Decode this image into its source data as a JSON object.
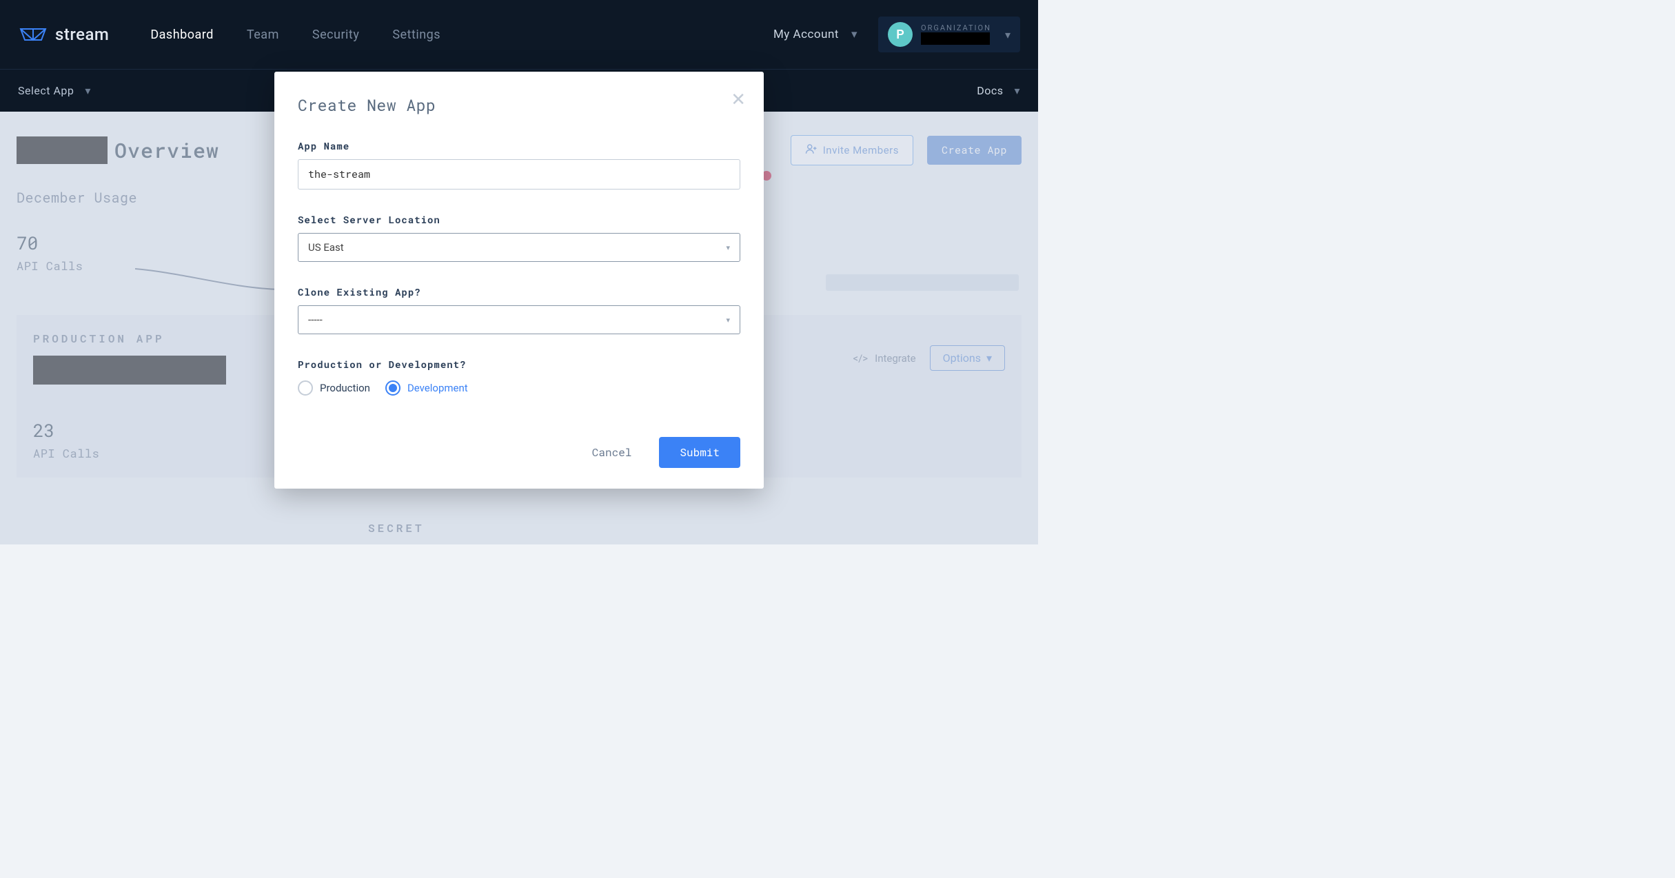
{
  "header": {
    "logo_text": "stream",
    "nav": {
      "dashboard": "Dashboard",
      "team": "Team",
      "security": "Security",
      "settings": "Settings"
    },
    "my_account": "My Account",
    "org_label": "ORGANIZATION",
    "avatar_letter": "P"
  },
  "subheader": {
    "select_app": "Select App",
    "docs": "Docs"
  },
  "page": {
    "overview_title": "Overview",
    "invite_label": "Invite Members",
    "create_app_label": "Create App",
    "usage_title": "December Usage",
    "stat1_num": "70",
    "stat1_label": "API Calls",
    "prod_app_label": "PRODUCTION APP",
    "integrate_label": "Integrate",
    "integrate_icon": "</>",
    "options_label": "Options",
    "stat2_num": "23",
    "stat2_label": "API Calls",
    "secret_label": "SECRET"
  },
  "modal": {
    "title": "Create New App",
    "app_name_label": "App Name",
    "app_name_value": "the-stream",
    "server_label": "Select Server Location",
    "server_value": "US East",
    "clone_label": "Clone Existing App?",
    "clone_value": "-----",
    "env_label": "Production or Development?",
    "production_label": "Production",
    "development_label": "Development",
    "cancel_label": "Cancel",
    "submit_label": "Submit"
  }
}
